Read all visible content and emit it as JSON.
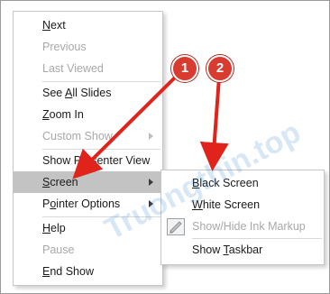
{
  "main_menu": {
    "items": [
      {
        "label": "Next",
        "mnemonic": "N",
        "rest": "ext",
        "state": "enabled"
      },
      {
        "label": "Previous",
        "state": "disabled"
      },
      {
        "label": "Last Viewed",
        "state": "disabled"
      },
      {
        "label": "See All Slides",
        "pre": "See ",
        "mnemonic": "A",
        "rest": "ll Slides",
        "state": "enabled"
      },
      {
        "label": "Zoom In",
        "mnemonic": "Z",
        "rest": "oom In",
        "state": "enabled"
      },
      {
        "label": "Custom Show",
        "state": "disabled"
      },
      {
        "label": "Show Presenter View",
        "state": "enabled"
      },
      {
        "label": "Screen",
        "mnemonic": "S",
        "rest": "creen",
        "state": "highlighted"
      },
      {
        "label": "Pointer Options",
        "pre": "P",
        "mnemonic": "o",
        "rest": "inter Options",
        "state": "enabled"
      },
      {
        "label": "Help",
        "mnemonic": "H",
        "rest": "elp",
        "state": "enabled"
      },
      {
        "label": "Pause",
        "state": "disabled"
      },
      {
        "label": "End Show",
        "mnemonic": "E",
        "rest": "nd Show",
        "state": "enabled"
      }
    ]
  },
  "sub_menu": {
    "items": [
      {
        "label": "Black Screen",
        "mnemonic": "B",
        "rest": "lack Screen",
        "state": "enabled"
      },
      {
        "label": "White Screen",
        "mnemonic": "W",
        "rest": "hite Screen",
        "state": "enabled"
      },
      {
        "label": "Show/Hide Ink Markup",
        "state": "disabled",
        "icon": "ink-markup-icon"
      },
      {
        "label": "Show Taskbar",
        "pre": "Show ",
        "mnemonic": "T",
        "rest": "askbar",
        "state": "enabled"
      }
    ]
  },
  "annotations": {
    "badge_1": "1",
    "badge_2": "2",
    "arrow_color": "#e0241b"
  },
  "watermark": {
    "text": "Truongthin.top"
  },
  "colors": {
    "highlight": "#c3c3c3",
    "disabled_text": "#a8a8a8",
    "badge": "#d83b30"
  }
}
